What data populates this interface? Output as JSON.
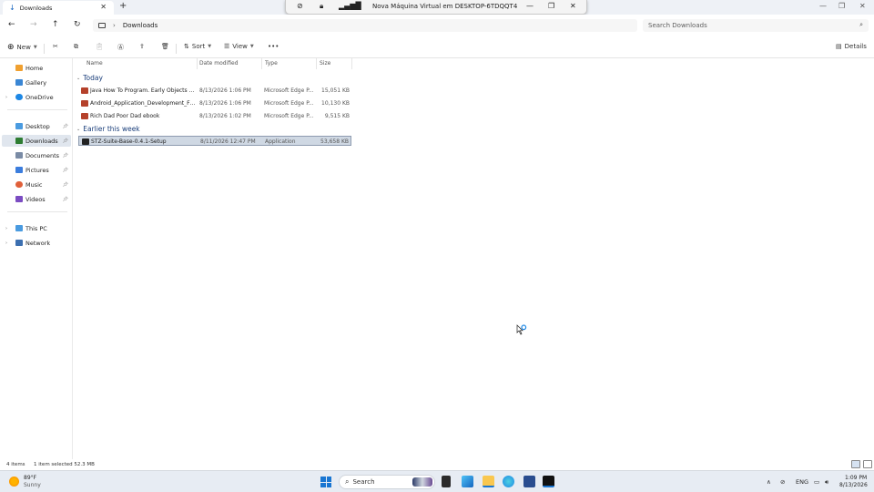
{
  "window": {
    "tab_title": "Downloads",
    "vm_title": "Nova Máquina Virtual em DESKTOP-6TDQQT4"
  },
  "address": {
    "crumb": "Downloads",
    "search_placeholder": "Search Downloads"
  },
  "toolbar": {
    "new_label": "New",
    "sort_label": "Sort",
    "view_label": "View",
    "more_label": "•••",
    "details_label": "Details"
  },
  "sidebar": {
    "items": [
      {
        "label": "Home",
        "icon": "home-icon"
      },
      {
        "label": "Gallery",
        "icon": "gallery-icon"
      },
      {
        "label": "OneDrive",
        "icon": "cloud-icon"
      },
      {
        "label": "Desktop",
        "icon": "desktop-icon"
      },
      {
        "label": "Downloads",
        "icon": "download-icon"
      },
      {
        "label": "Documents",
        "icon": "document-icon"
      },
      {
        "label": "Pictures",
        "icon": "pictures-icon"
      },
      {
        "label": "Music",
        "icon": "music-icon"
      },
      {
        "label": "Videos",
        "icon": "videos-icon"
      },
      {
        "label": "This PC",
        "icon": "pc-icon"
      },
      {
        "label": "Network",
        "icon": "network-icon"
      }
    ]
  },
  "columns": {
    "name": "Name",
    "date": "Date modified",
    "type": "Type",
    "size": "Size"
  },
  "groups": [
    {
      "label": "Today",
      "files": [
        {
          "name": "Java How To Program. Early Objects by P...",
          "date": "8/13/2026 1:06 PM",
          "type": "Microsoft Edge P...",
          "size": "15,051 KB"
        },
        {
          "name": "Android_Application_Development_For_...",
          "date": "8/13/2026 1:06 PM",
          "type": "Microsoft Edge P...",
          "size": "10,130 KB"
        },
        {
          "name": "Rich Dad Poor Dad ebook",
          "date": "8/13/2026 1:02 PM",
          "type": "Microsoft Edge P...",
          "size": "9,515 KB"
        }
      ]
    },
    {
      "label": "Earlier this week",
      "files": [
        {
          "name": "STZ-Suite-Base-0.4.1-Setup",
          "date": "8/11/2026 12:47 PM",
          "type": "Application",
          "size": "53,658 KB"
        }
      ]
    }
  ],
  "status": {
    "items_count": "4 items",
    "selection": "1 item selected  52.3 MB"
  },
  "taskbar": {
    "temp": "89°F",
    "condition": "Sunny",
    "search_label": "Search",
    "lang": "ENG",
    "time": "1:09 PM",
    "date": "8/13/2026"
  },
  "colors": {
    "accent": "#1976d2",
    "pdf": "#b5412b",
    "selection": "#cfd8e3"
  }
}
